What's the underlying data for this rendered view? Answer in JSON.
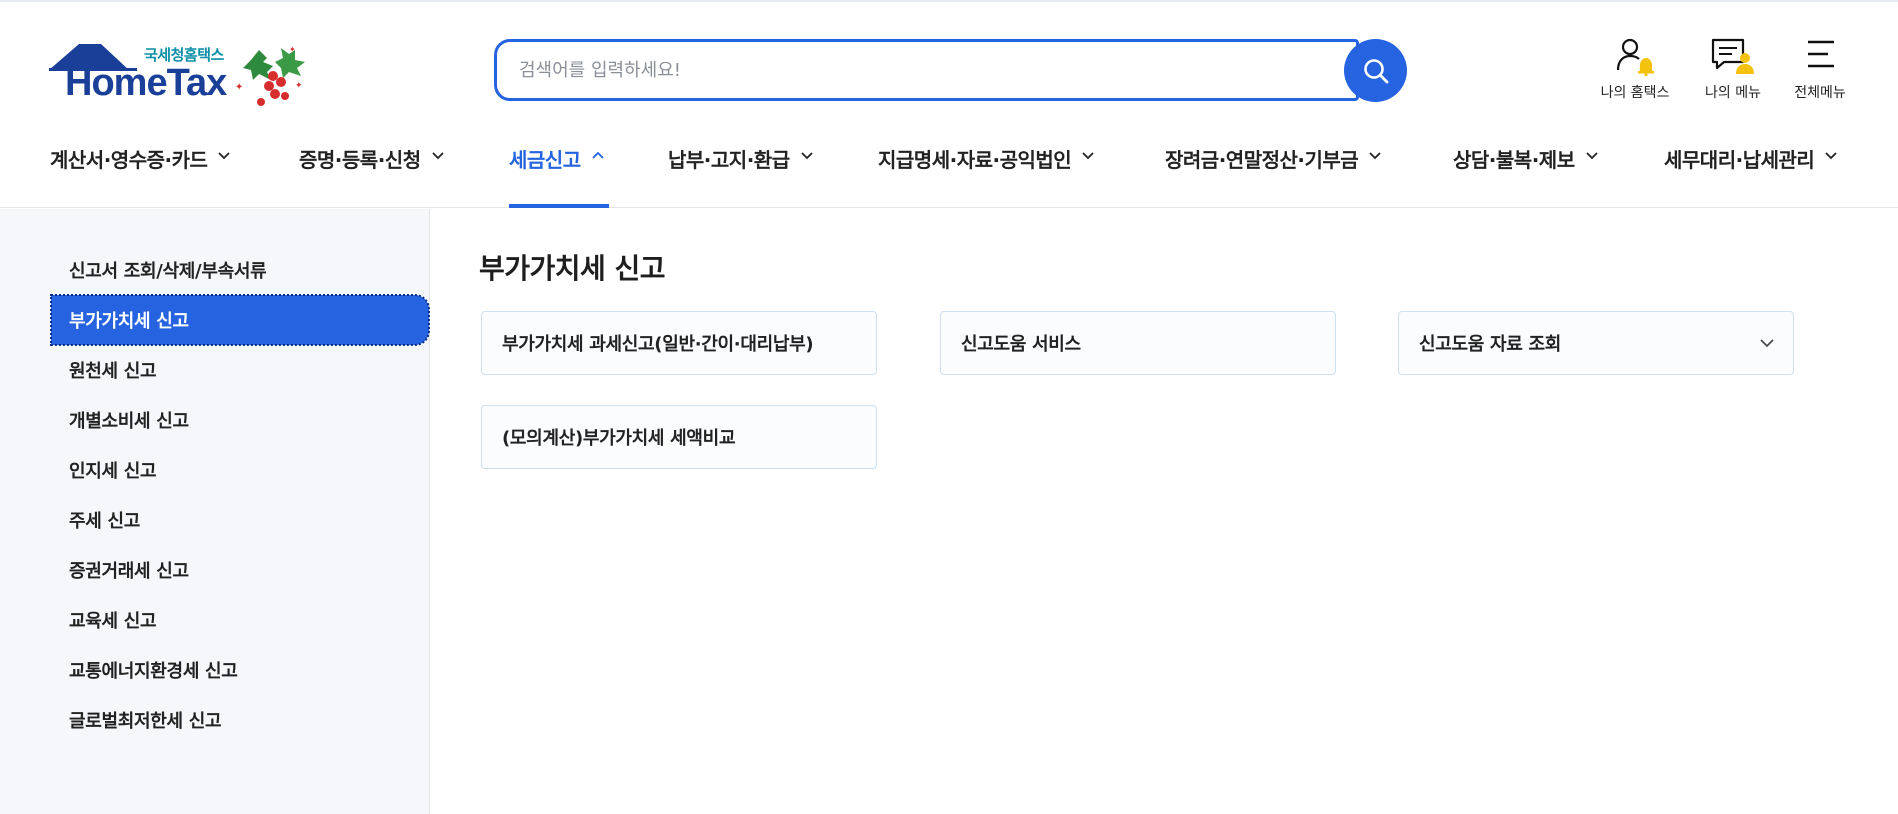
{
  "header": {
    "logo_small": "국세청홈택스",
    "logo_big": "HomeTax",
    "search_placeholder": "검색어를 입력하세요!",
    "utility": [
      {
        "label": "나의 홈택스",
        "icon": "person-bell-icon"
      },
      {
        "label": "나의 메뉴",
        "icon": "chat-person-icon"
      },
      {
        "label": "전체메뉴",
        "icon": "hamburger-menu-icon"
      }
    ]
  },
  "nav": {
    "items": [
      {
        "label": "계산서·영수증·카드"
      },
      {
        "label": "증명·등록·신청"
      },
      {
        "label": "세금신고",
        "active": true
      },
      {
        "label": "납부·고지·환급"
      },
      {
        "label": "지급명세·자료·공익법인"
      },
      {
        "label": "장려금·연말정산·기부금"
      },
      {
        "label": "상담·불복·제보"
      },
      {
        "label": "세무대리·납세관리"
      }
    ]
  },
  "sidebar": {
    "items": [
      {
        "label": "신고서 조회/삭제/부속서류"
      },
      {
        "label": "부가가치세 신고",
        "active": true
      },
      {
        "label": "원천세 신고"
      },
      {
        "label": "개별소비세 신고"
      },
      {
        "label": "인지세 신고"
      },
      {
        "label": "주세 신고"
      },
      {
        "label": "증권거래세 신고"
      },
      {
        "label": "교육세 신고"
      },
      {
        "label": "교통에너지환경세 신고"
      },
      {
        "label": "글로벌최저한세 신고"
      }
    ]
  },
  "main": {
    "title": "부가가치세 신고",
    "cards": [
      {
        "label": "부가가치세 과세신고(일반·간이·대리납부)"
      },
      {
        "label": "신고도움 서비스"
      },
      {
        "label": "신고도움 자료 조회",
        "has_dropdown": true
      },
      {
        "label": "(모의계산)부가가치세 세액비교"
      }
    ]
  },
  "colors": {
    "accent": "#2563e0",
    "logo_blue": "#1a3f98",
    "logo_teal": "#0b8fa8",
    "sidebar_bg": "#f5f7fa"
  }
}
